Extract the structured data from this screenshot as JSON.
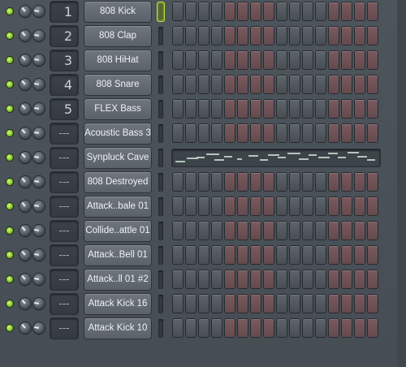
{
  "channel_rack": {
    "channels": [
      {
        "number": "1",
        "name": "808 Kick",
        "selected": true,
        "mode": "steps"
      },
      {
        "number": "2",
        "name": "808 Clap",
        "selected": false,
        "mode": "steps"
      },
      {
        "number": "3",
        "name": "808 HiHat",
        "selected": false,
        "mode": "steps"
      },
      {
        "number": "4",
        "name": "808 Snare",
        "selected": false,
        "mode": "steps"
      },
      {
        "number": "5",
        "name": "FLEX Bass",
        "selected": false,
        "mode": "steps"
      },
      {
        "number": "---",
        "name": "Acoustic Bass 3",
        "selected": false,
        "mode": "steps"
      },
      {
        "number": "---",
        "name": "Synpluck Cave",
        "selected": false,
        "mode": "piano"
      },
      {
        "number": "---",
        "name": "808 Destroyed",
        "selected": false,
        "mode": "steps"
      },
      {
        "number": "---",
        "name": "Attack..bale 01",
        "selected": false,
        "mode": "steps"
      },
      {
        "number": "---",
        "name": "Collide..attle 01",
        "selected": false,
        "mode": "steps"
      },
      {
        "number": "---",
        "name": "Attack..Bell 01",
        "selected": false,
        "mode": "steps"
      },
      {
        "number": "---",
        "name": "Attack..ll 01 #2",
        "selected": false,
        "mode": "steps"
      },
      {
        "number": "---",
        "name": "Attack Kick 16",
        "selected": false,
        "mode": "steps"
      },
      {
        "number": "---",
        "name": "Attack Kick 10",
        "selected": false,
        "mode": "steps"
      }
    ],
    "step_count": 16,
    "step_group_colors": [
      "dark",
      "red",
      "dark",
      "red"
    ],
    "colors": {
      "led_on": "#7cc127",
      "step_dark": "#54595f",
      "step_red": "#6e5256",
      "selected_outline": "#b6e33e",
      "background": "#4a5259"
    }
  }
}
